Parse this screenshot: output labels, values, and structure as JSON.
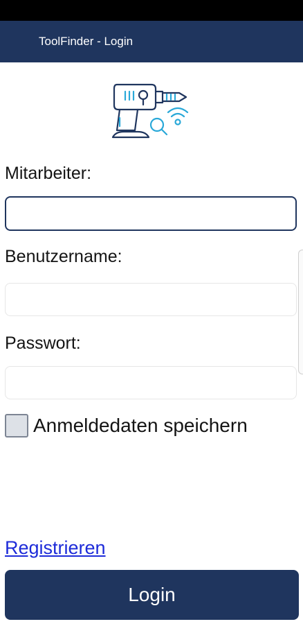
{
  "appbar": {
    "title": "ToolFinder - Login"
  },
  "form": {
    "employee": {
      "label": "Mitarbeiter:",
      "value": ""
    },
    "username": {
      "label": "Benutzername:",
      "value": ""
    },
    "password": {
      "label": "Passwort:",
      "value": ""
    },
    "remember": {
      "label": "Anmeldedaten speichern",
      "checked": false
    }
  },
  "register_link": "Registrieren",
  "login_button": "Login",
  "colors": {
    "primary": "#1f355e",
    "accent": "#29a8d8",
    "link": "#1d2bd9"
  },
  "icons": {
    "logo": "drill-search-wifi-icon"
  }
}
